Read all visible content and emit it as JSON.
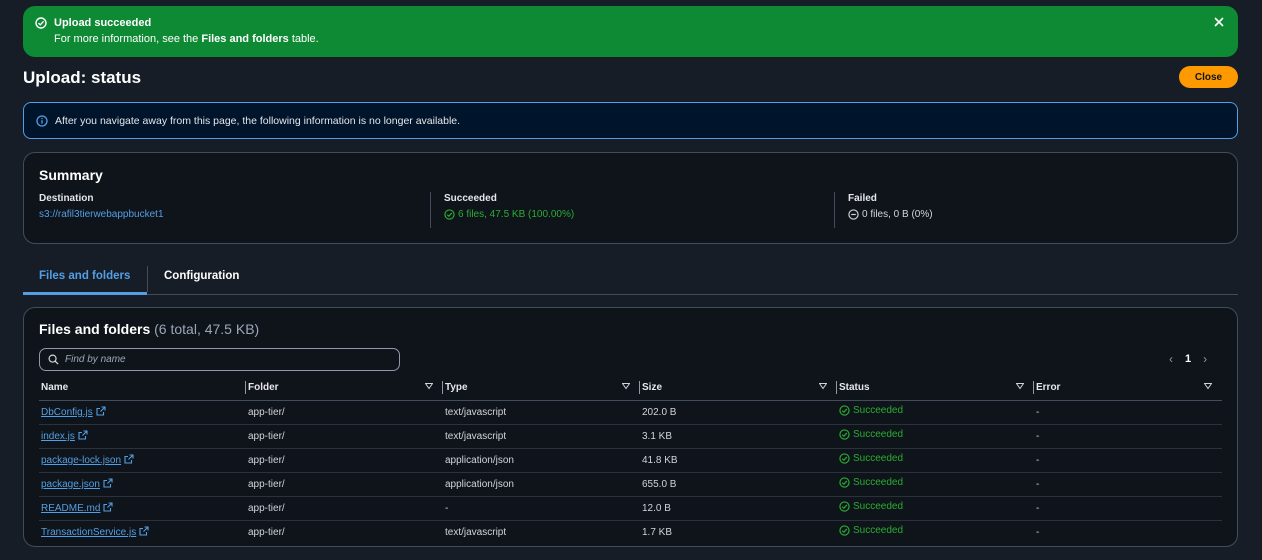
{
  "flash": {
    "title": "Upload succeeded",
    "message_prefix": "For more information, see the ",
    "message_bold": "Files and folders",
    "message_suffix": " table.",
    "color": "#0e8a34"
  },
  "page": {
    "title": "Upload: status",
    "close_label": "Close"
  },
  "info": {
    "text": "After you navigate away from this page, the following information is no longer available."
  },
  "summary": {
    "heading": "Summary",
    "destination_label": "Destination",
    "destination_value": "s3://rafil3tierwebappbucket1",
    "succeeded_label": "Succeeded",
    "succeeded_value": "6 files, 47.5 KB (100.00%)",
    "failed_label": "Failed",
    "failed_value": "0 files, 0 B (0%)"
  },
  "tabs": {
    "files": "Files and folders",
    "config": "Configuration"
  },
  "files": {
    "heading": "Files and folders",
    "count": "(6 total, 47.5 KB)",
    "search_placeholder": "Find by name",
    "page_number": "1",
    "columns": [
      "Name",
      "Folder",
      "Type",
      "Size",
      "Status",
      "Error"
    ],
    "rows": [
      {
        "name": "DbConfig.js",
        "folder": "app-tier/",
        "type": "text/javascript",
        "size": "202.0 B",
        "status": "Succeeded",
        "error": "-"
      },
      {
        "name": "index.js",
        "folder": "app-tier/",
        "type": "text/javascript",
        "size": "3.1 KB",
        "status": "Succeeded",
        "error": "-"
      },
      {
        "name": "package-lock.json",
        "folder": "app-tier/",
        "type": "application/json",
        "size": "41.8 KB",
        "status": "Succeeded",
        "error": "-"
      },
      {
        "name": "package.json",
        "folder": "app-tier/",
        "type": "application/json",
        "size": "655.0 B",
        "status": "Succeeded",
        "error": "-"
      },
      {
        "name": "README.md",
        "folder": "app-tier/",
        "type": "-",
        "size": "12.0 B",
        "status": "Succeeded",
        "error": "-"
      },
      {
        "name": "TransactionService.js",
        "folder": "app-tier/",
        "type": "text/javascript",
        "size": "1.7 KB",
        "status": "Succeeded",
        "error": "-"
      }
    ]
  },
  "colors": {
    "accent": "#539fe5",
    "success": "#29ad32",
    "primary_button": "#ff9900"
  }
}
